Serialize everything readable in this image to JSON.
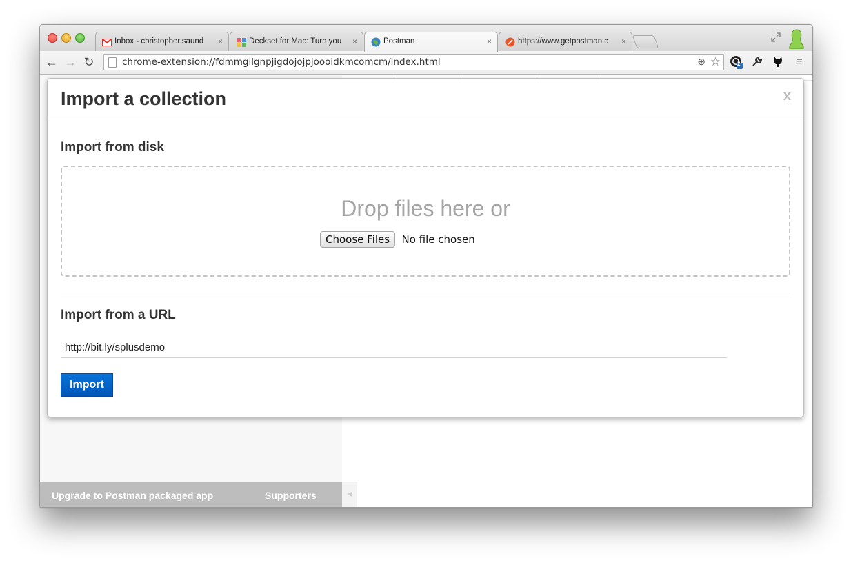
{
  "browser": {
    "tabs": [
      {
        "title": "Inbox - christopher.saund",
        "icon": "gmail-icon",
        "active": false
      },
      {
        "title": "Deckset for Mac: Turn you",
        "icon": "deckset-icon",
        "active": false
      },
      {
        "title": "Postman",
        "icon": "postman-icon",
        "active": true
      },
      {
        "title": "https://www.getpostman.c",
        "icon": "safari-icon",
        "active": false
      }
    ],
    "tab_close_glyph": "×",
    "url": "chrome-extension://fdmmgilgnpjigdojojpjoooidkmcomcm/index.html",
    "extension_badge": "2"
  },
  "sidebar": {
    "upgrade_link": "Upgrade to Postman packaged app",
    "supporters_link": "Supporters",
    "collapse_glyph": "◀"
  },
  "modal": {
    "title": "Import a collection",
    "close_label": "x",
    "disk_section_title": "Import from disk",
    "drop_text": "Drop files here or",
    "choose_files_label": "Choose Files",
    "no_file_text": "No file chosen",
    "url_section_title": "Import from a URL",
    "url_value": "http://bit.ly/splusdemo",
    "import_button_label": "Import"
  },
  "colors": {
    "accent": "#0a6fd6",
    "bottombar": "#bdbdbd"
  }
}
